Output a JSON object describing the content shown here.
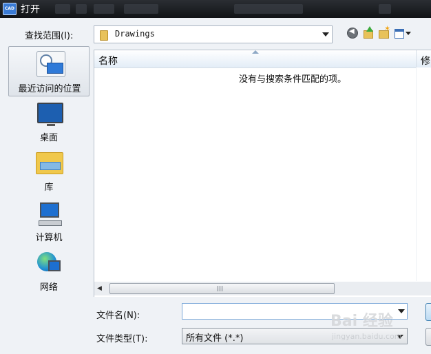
{
  "window": {
    "title": "打开",
    "app_icon_text": "CAD"
  },
  "toolbar": {
    "look_in_label": "查找范围(I):",
    "look_in_value": "Drawings",
    "back_icon": "back-icon",
    "up_icon": "up-folder-icon",
    "new_folder_icon": "new-folder-icon",
    "views_icon": "views-menu-icon"
  },
  "places": [
    {
      "label": "最近访问的位置",
      "icon": "recent-places-icon"
    },
    {
      "label": "桌面",
      "icon": "desktop-icon"
    },
    {
      "label": "库",
      "icon": "libraries-icon"
    },
    {
      "label": "计算机",
      "icon": "computer-icon"
    },
    {
      "label": "网络",
      "icon": "network-icon"
    }
  ],
  "file_list": {
    "columns": [
      "名称",
      "修"
    ],
    "empty_message": "没有与搜索条件匹配的项。",
    "hscroll_grip": "III"
  },
  "footer": {
    "file_name_label": "文件名(N):",
    "file_name_value": "",
    "file_type_label": "文件类型(T):",
    "file_type_value": "所有文件 (*.*)"
  },
  "watermark": {
    "text": "Bai 经验",
    "sub": "jingyan.baidu.com"
  }
}
